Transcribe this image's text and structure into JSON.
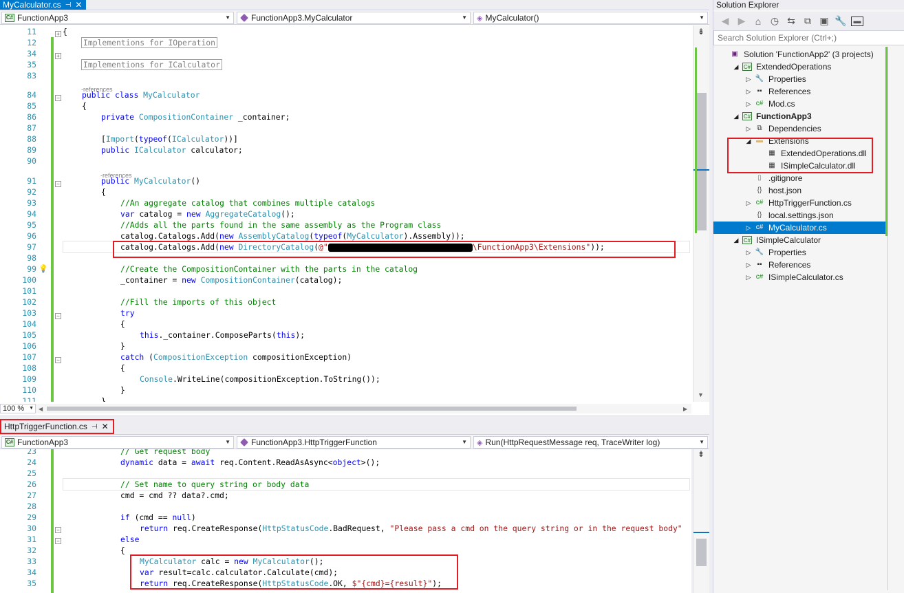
{
  "colors": {
    "keyword": "#0000ff",
    "type": "#2b91af",
    "comment": "#008000",
    "string": "#a31515",
    "accent": "#007acc",
    "highlight": "#e31b23",
    "change_bar": "#6cc644"
  },
  "top_editor": {
    "tab": {
      "title": "MyCalculator.cs",
      "pin_icon": "pin-icon",
      "close_icon": "close-icon"
    },
    "nav": {
      "project": "FunctionApp3",
      "class": "FunctionApp3.MyCalculator",
      "member": "MyCalculator()"
    },
    "zoom": "100 %",
    "lines": [
      {
        "n": "11",
        "code": "{"
      },
      {
        "n": "12",
        "code": "Implementions for IOperation"
      },
      {
        "n": "34",
        "code": ""
      },
      {
        "n": "35",
        "code": "Implementions for ICalculator"
      },
      {
        "n": "83",
        "code": ""
      },
      {
        "n": "84",
        "code": "public class MyCalculator"
      },
      {
        "n": "85",
        "code": "{"
      },
      {
        "n": "86",
        "code": "private CompositionContainer _container;"
      },
      {
        "n": "87",
        "code": ""
      },
      {
        "n": "88",
        "code": "[Import(typeof(ICalculator))]"
      },
      {
        "n": "89",
        "code": "public ICalculator calculator;"
      },
      {
        "n": "90",
        "code": ""
      },
      {
        "n": "91",
        "code": "public MyCalculator()"
      },
      {
        "n": "92",
        "code": "{"
      },
      {
        "n": "93",
        "code": "//An aggregate catalog that combines multiple catalogs"
      },
      {
        "n": "94",
        "code": "var catalog = new AggregateCatalog();"
      },
      {
        "n": "95",
        "code": "//Adds all the parts found in the same assembly as the Program class"
      },
      {
        "n": "96",
        "code": "catalog.Catalogs.Add(new AssemblyCatalog(typeof(MyCalculator).Assembly));"
      },
      {
        "n": "97",
        "code": "catalog.Catalogs.Add(new DirectoryCatalog(@\"\\FunctionApp3\\Extensions\"));"
      },
      {
        "n": "98",
        "code": ""
      },
      {
        "n": "99",
        "code": "//Create the CompositionContainer with the parts in the catalog"
      },
      {
        "n": "100",
        "code": "_container = new CompositionContainer(catalog);"
      },
      {
        "n": "101",
        "code": ""
      },
      {
        "n": "102",
        "code": "//Fill the imports of this object"
      },
      {
        "n": "103",
        "code": "try"
      },
      {
        "n": "104",
        "code": "{"
      },
      {
        "n": "105",
        "code": "this._container.ComposeParts(this);"
      },
      {
        "n": "106",
        "code": "}"
      },
      {
        "n": "107",
        "code": "catch (CompositionException compositionException)"
      },
      {
        "n": "108",
        "code": "{"
      },
      {
        "n": "109",
        "code": "Console.WriteLine(compositionException.ToString());"
      },
      {
        "n": "110",
        "code": "}"
      },
      {
        "n": "111",
        "code": "}"
      }
    ],
    "refs_label": "references"
  },
  "bottom_editor": {
    "tab": {
      "title": "HttpTriggerFunction.cs",
      "pin_icon": "pin-icon",
      "close_icon": "close-icon"
    },
    "nav": {
      "project": "FunctionApp3",
      "class": "FunctionApp3.HttpTriggerFunction",
      "member": "Run(HttpRequestMessage req, TraceWriter log)"
    },
    "lines": [
      {
        "n": "23",
        "code": "// Get request body"
      },
      {
        "n": "24",
        "code": "dynamic data = await req.Content.ReadAsAsync<object>();"
      },
      {
        "n": "25",
        "code": ""
      },
      {
        "n": "26",
        "code": "// Set name to query string or body data"
      },
      {
        "n": "27",
        "code": "cmd = cmd ?? data?.cmd;"
      },
      {
        "n": "28",
        "code": ""
      },
      {
        "n": "29",
        "code": "if (cmd == null)"
      },
      {
        "n": "30",
        "code": "return req.CreateResponse(HttpStatusCode.BadRequest, \"Please pass a cmd on the query string or in the request body\""
      },
      {
        "n": "31",
        "code": "else"
      },
      {
        "n": "32",
        "code": "{"
      },
      {
        "n": "33",
        "code": "MyCalculator calc = new MyCalculator();"
      },
      {
        "n": "34",
        "code": "var result=calc.calculator.Calculate(cmd);"
      },
      {
        "n": "35",
        "code": "return req.CreateResponse(HttpStatusCode.OK, $\"{cmd}={result}\");"
      }
    ]
  },
  "solution_explorer": {
    "title": "Solution Explorer",
    "search_placeholder": "Search Solution Explorer (Ctrl+;)",
    "toolbar_icons": [
      "back-icon",
      "forward-icon",
      "home-icon",
      "history-icon",
      "sync-icon",
      "collapse-icon",
      "show-all-icon",
      "properties-wrench-icon",
      "pin-toolbar-icon"
    ],
    "items": [
      {
        "label": "Solution 'FunctionApp2' (3 projects)",
        "icon": "solution-icon"
      },
      {
        "label": "ExtendedOperations",
        "icon": "csharp-project-icon"
      },
      {
        "label": "Properties",
        "icon": "wrench-icon"
      },
      {
        "label": "References",
        "icon": "references-icon"
      },
      {
        "label": "Mod.cs",
        "icon": "csharp-file-icon"
      },
      {
        "label": "FunctionApp3",
        "icon": "csharp-project-icon"
      },
      {
        "label": "Dependencies",
        "icon": "dependencies-icon"
      },
      {
        "label": "Extensions",
        "icon": "folder-icon"
      },
      {
        "label": "ExtendedOperations.dll",
        "icon": "dll-icon"
      },
      {
        "label": "ISimpleCalculator.dll",
        "icon": "dll-icon"
      },
      {
        "label": ".gitignore",
        "icon": "file-icon"
      },
      {
        "label": "host.json",
        "icon": "json-icon"
      },
      {
        "label": "HttpTriggerFunction.cs",
        "icon": "csharp-file-icon"
      },
      {
        "label": "local.settings.json",
        "icon": "json-icon"
      },
      {
        "label": "MyCalculator.cs",
        "icon": "csharp-file-icon"
      },
      {
        "label": "ISimpleCalculator",
        "icon": "csharp-project-icon"
      },
      {
        "label": "Properties",
        "icon": "wrench-icon"
      },
      {
        "label": "References",
        "icon": "references-icon"
      },
      {
        "label": "ISimpleCalculator.cs",
        "icon": "csharp-file-icon"
      }
    ]
  }
}
